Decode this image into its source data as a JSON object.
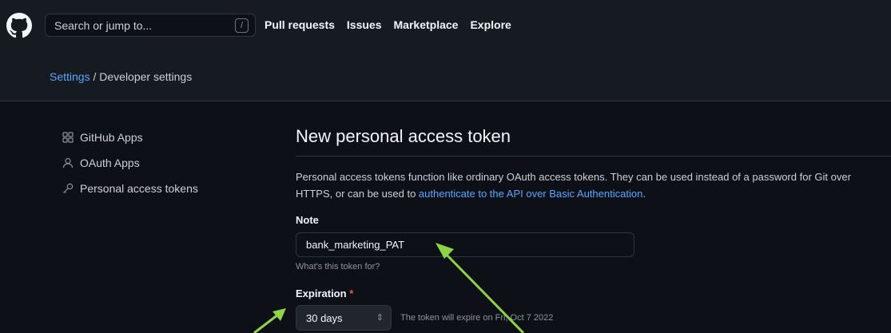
{
  "header": {
    "search_placeholder": "Search or jump to...",
    "search_shortcut": "/",
    "nav": [
      "Pull requests",
      "Issues",
      "Marketplace",
      "Explore"
    ]
  },
  "breadcrumb": {
    "settings": "Settings",
    "separator": "/",
    "current": "Developer settings"
  },
  "sidebar": {
    "items": [
      {
        "label": "GitHub Apps",
        "icon": "apps-grid-icon"
      },
      {
        "label": "OAuth Apps",
        "icon": "person-icon"
      },
      {
        "label": "Personal access tokens",
        "icon": "key-icon"
      }
    ]
  },
  "main": {
    "title": "New personal access token",
    "description_part1": "Personal access tokens function like ordinary OAuth access tokens. They can be used instead of a password for Git over HTTPS, or can be used to ",
    "description_link": "authenticate to the API over Basic Authentication",
    "description_part2": ".",
    "note": {
      "label": "Note",
      "value": "bank_marketing_PAT",
      "hint": "What's this token for?"
    },
    "expiration": {
      "label": "Expiration",
      "required_mark": "*",
      "selected": "30 days",
      "caret": "⇕",
      "info": "The token will expire on Fri, Oct 7 2022"
    }
  },
  "colors": {
    "background": "#0d1117",
    "header": "#161b22",
    "link": "#58a6ff",
    "annotation_arrow": "#8ed444"
  }
}
